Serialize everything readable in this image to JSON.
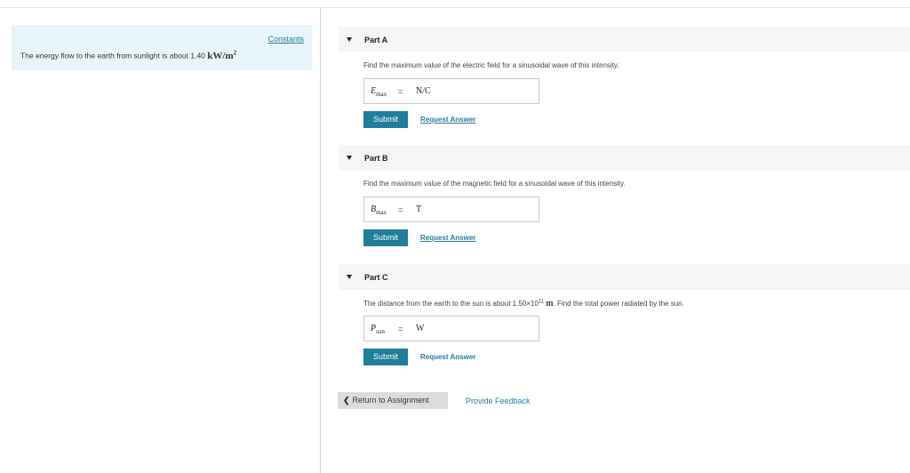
{
  "constants_link": "Constants",
  "intro": {
    "text": "The energy flow to the earth from sunlight is about 1.40",
    "unit": "kW/m",
    "unit_exp": "2"
  },
  "parts": [
    {
      "title": "Part A",
      "question": "Find the maximum value of the electric field for a sinusoidal wave of this intensity.",
      "var_symbol": "E",
      "var_sub": "max",
      "equals": "=",
      "unit": "N/C",
      "submit": "Submit",
      "request": "Request Answer"
    },
    {
      "title": "Part B",
      "question": "Find the maximum value of the magnetic field for a sinusoidal wave of this intensity.",
      "var_symbol": "B",
      "var_sub": "max",
      "equals": "=",
      "unit": "T",
      "submit": "Submit",
      "request": "Request Answer"
    },
    {
      "title": "Part C",
      "question_pre": "The distance from the earth to the sun is about 1.50×10",
      "question_exp": "11",
      "question_unit": "m",
      "question_post": ". Find the total power radiated by the sun.",
      "var_symbol": "P",
      "var_sub": "sun",
      "equals": "=",
      "unit": "W",
      "submit": "Submit",
      "request": "Request Answer"
    }
  ],
  "footer": {
    "return_label": "Return to Assignment",
    "feedback_label": "Provide Feedback"
  }
}
